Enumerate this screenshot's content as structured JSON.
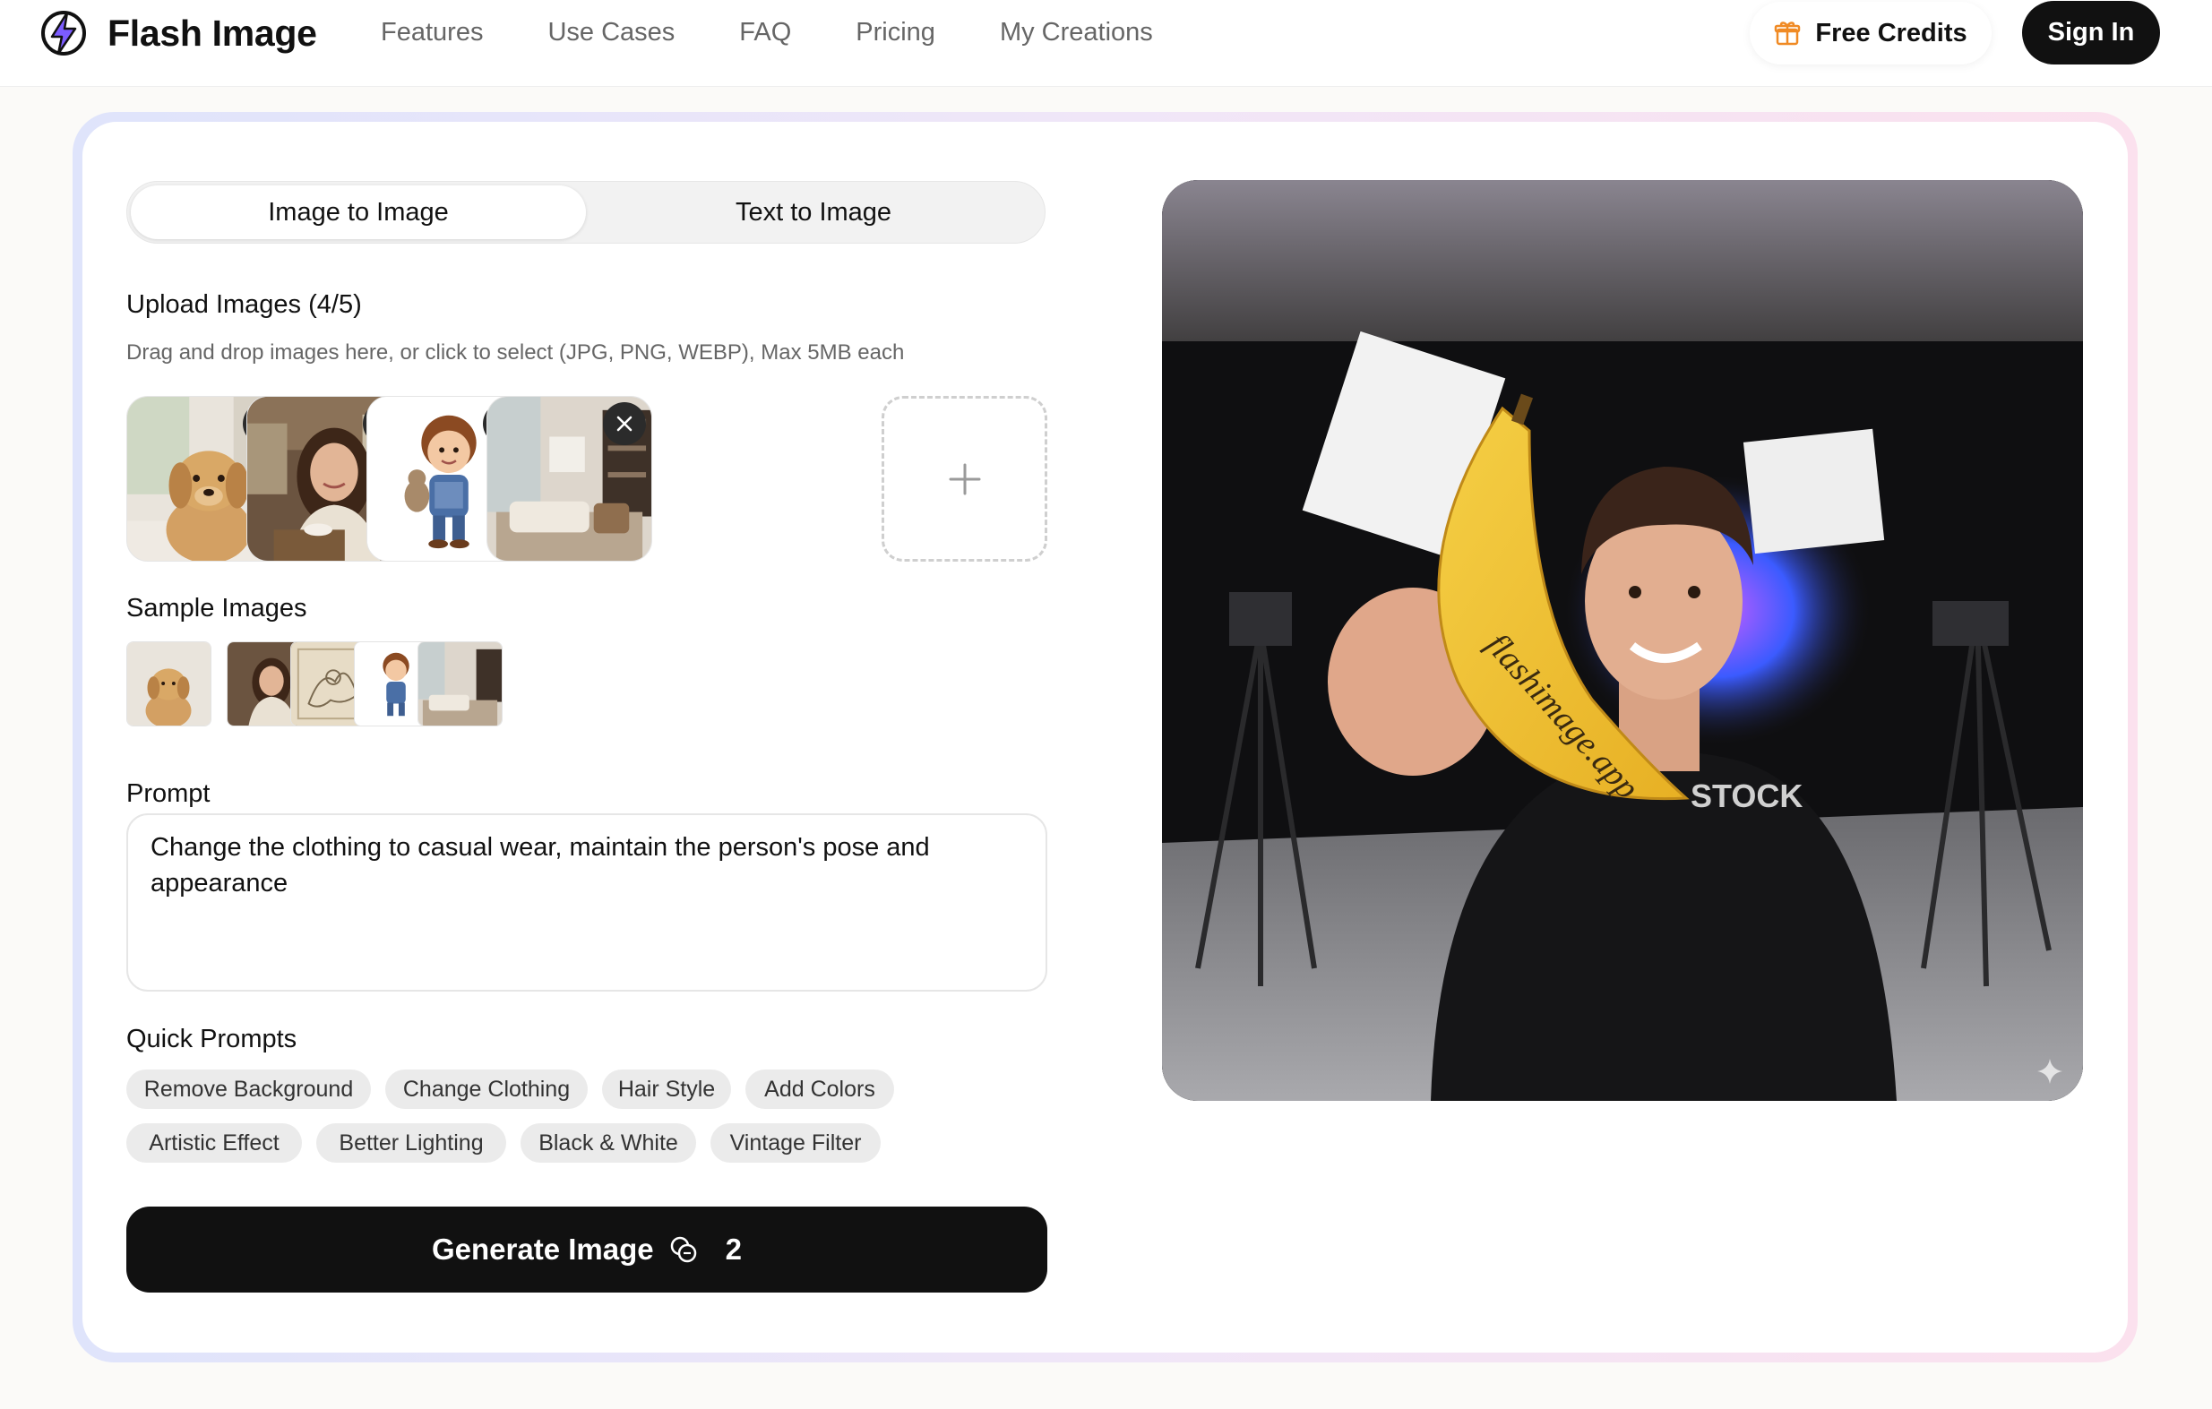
{
  "brand": {
    "name": "Flash Image"
  },
  "nav": {
    "links": [
      "Features",
      "Use Cases",
      "FAQ",
      "Pricing",
      "My Creations"
    ],
    "free_credits": "Free Credits",
    "sign_in": "Sign In"
  },
  "tabs": {
    "image_to_image": "Image to Image",
    "text_to_image": "Text to Image",
    "active": "image_to_image"
  },
  "upload": {
    "title": "Upload Images (4/5)",
    "hint": "Drag and drop images here, or click to select (JPG, PNG, WEBP), Max 5MB each",
    "images": [
      "golden retriever puppy",
      "woman in cafe",
      "cartoon boy with teddy bear",
      "living room interior"
    ]
  },
  "samples": {
    "title": "Sample Images"
  },
  "prompt": {
    "label": "Prompt",
    "value": "Change the clothing to casual wear, maintain the person's pose and appearance"
  },
  "quick_prompts": {
    "title": "Quick Prompts",
    "chips": [
      "Remove Background",
      "Change Clothing",
      "Hair Style",
      "Add Colors",
      "Artistic Effect",
      "Better Lighting",
      "Black & White",
      "Vintage Filter"
    ]
  },
  "generate": {
    "label": "Generate Image",
    "cost": "2"
  },
  "preview": {
    "banana_text": "flashimage.app",
    "hoodie_text": "STOCK"
  },
  "colors": {
    "accent": "#111111",
    "gift_icon": "#f08a24",
    "logo_bolt": "#7c5cff"
  }
}
